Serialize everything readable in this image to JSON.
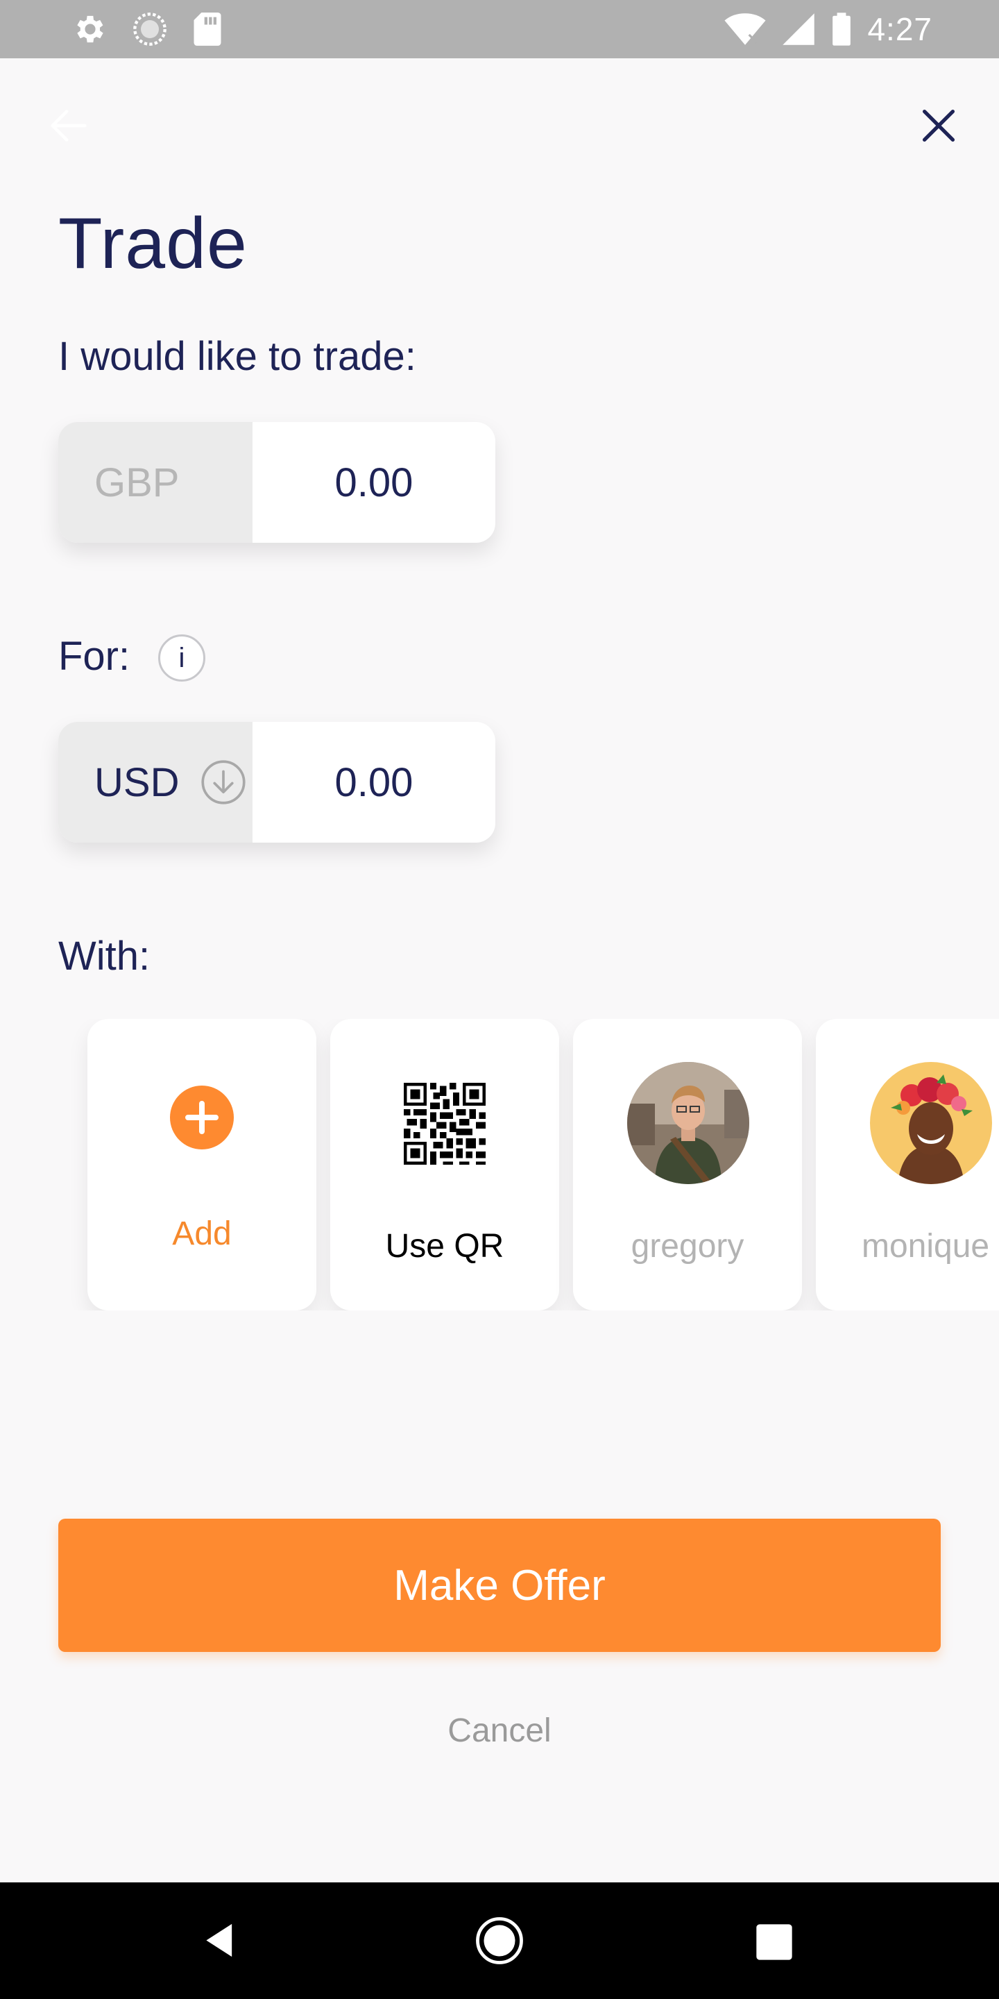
{
  "status_bar": {
    "time": "4:27",
    "icons": [
      "settings-icon",
      "sync-icon",
      "sd-card-icon",
      "wifi-icon",
      "signal-icon",
      "battery-icon"
    ]
  },
  "header": {
    "title": "Trade",
    "back_icon": "arrow-left-icon",
    "close_icon": "close-icon"
  },
  "trade": {
    "label": "I would like to trade:",
    "currency": "GBP",
    "amount": "0.00"
  },
  "for": {
    "label": "For:",
    "info": "i",
    "currency": "USD",
    "amount": "0.00",
    "dropdown_icon": "chevron-down-circle-icon"
  },
  "with": {
    "label": "With:",
    "cards": [
      {
        "label": "Add",
        "icon": "plus-circle-icon"
      },
      {
        "label": "Use QR",
        "icon": "qr-code-icon"
      },
      {
        "label": "gregory",
        "icon": "avatar"
      },
      {
        "label": "monique",
        "icon": "avatar"
      }
    ]
  },
  "actions": {
    "make_offer": "Make Offer",
    "cancel": "Cancel"
  },
  "colors": {
    "accent": "#fe8a30",
    "text_primary": "#1e2356",
    "background": "#f9f8f9",
    "status_bar": "#b1b1b1"
  }
}
